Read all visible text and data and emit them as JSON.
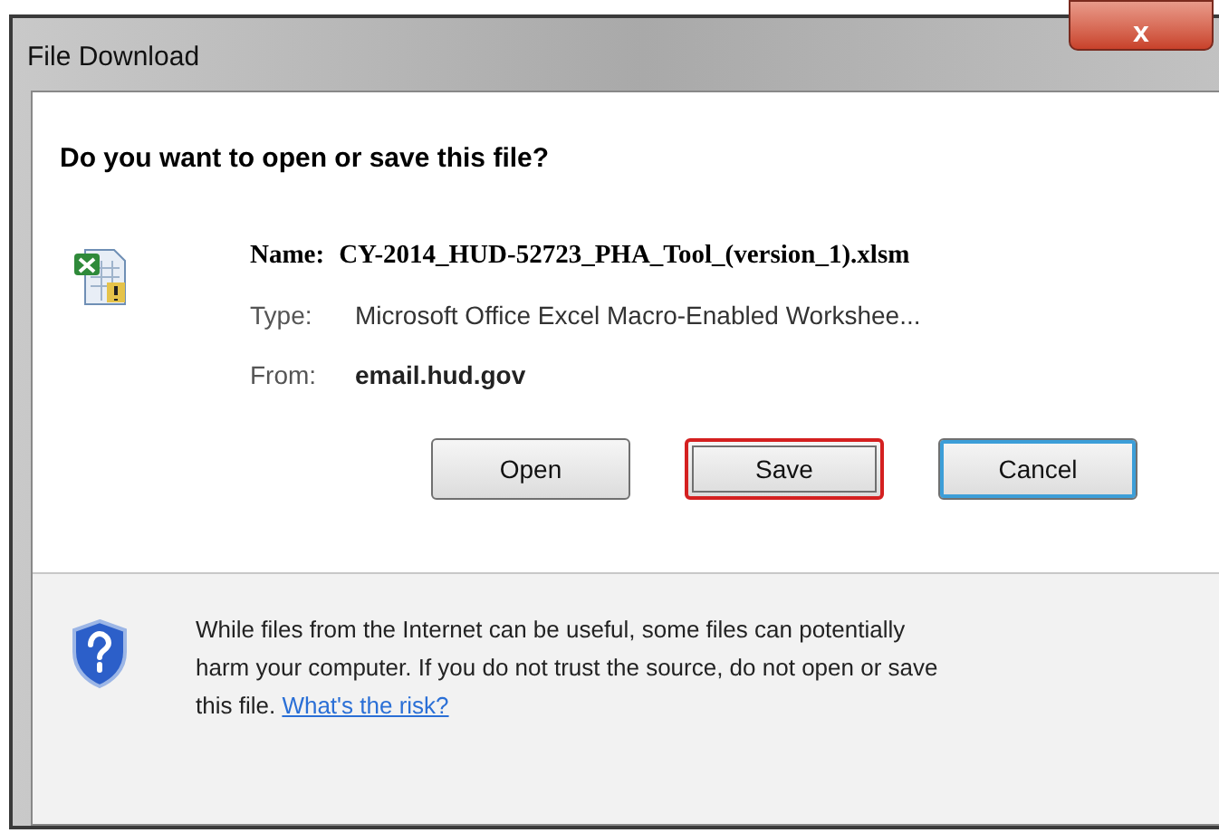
{
  "window": {
    "title": "File Download",
    "close": "x"
  },
  "heading": "Do you want to open or save this file?",
  "details": {
    "name_label": "Name:",
    "name": "CY-2014_HUD-52723_PHA_Tool_(version_1).xlsm",
    "type_label": "Type:",
    "type": "Microsoft Office Excel Macro-Enabled Workshee...",
    "from_label": "From:",
    "from": "email.hud.gov"
  },
  "buttons": [
    {
      "label": "Open",
      "focused": false,
      "highlighted": false
    },
    {
      "label": "Save",
      "focused": false,
      "highlighted": true
    },
    {
      "label": "Cancel",
      "focused": true,
      "highlighted": false
    }
  ],
  "warning": {
    "text": "While files from the Internet can be useful, some files can potentially harm your computer. If you do not trust the source, do not open or save this file.",
    "link": "What's the risk?"
  }
}
